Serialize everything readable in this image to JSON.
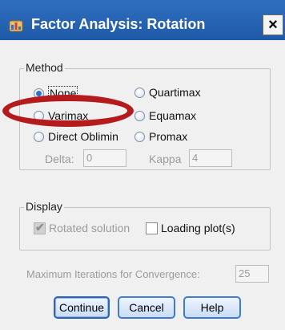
{
  "window": {
    "title": "Factor Analysis: Rotation",
    "close_label": "×"
  },
  "method": {
    "label": "Method",
    "options": [
      {
        "label": "None",
        "checked": true
      },
      {
        "label": "Varimax",
        "checked": false
      },
      {
        "label": "Direct Oblimin",
        "checked": false
      },
      {
        "label": "Quartimax",
        "checked": false
      },
      {
        "label": "Equamax",
        "checked": false
      },
      {
        "label": "Promax",
        "checked": false
      }
    ],
    "delta": {
      "label": "Delta:",
      "value": "0"
    },
    "kappa": {
      "label": "Kappa",
      "value": "4"
    }
  },
  "display": {
    "label": "Display",
    "rotated_solution": {
      "label": "Rotated solution",
      "checked": true,
      "enabled": false
    },
    "loading_plots": {
      "label": "Loading plot(s)",
      "checked": false
    }
  },
  "iterations": {
    "label": "Maximum Iterations for Convergence:",
    "value": "25"
  },
  "buttons": {
    "continue": "Continue",
    "cancel": "Cancel",
    "help": "Help"
  },
  "colors": {
    "titlebar": "#2f6fbf",
    "annotation": "#b51a1c"
  }
}
